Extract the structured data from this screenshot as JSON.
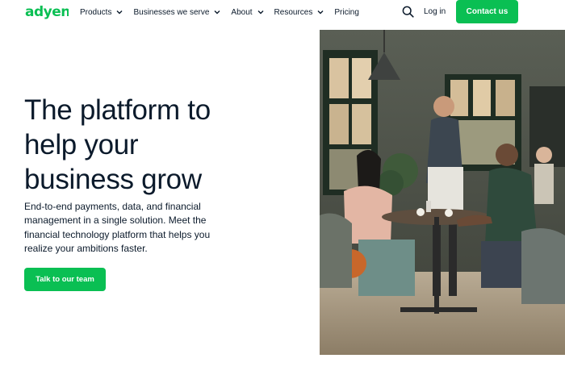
{
  "brand": {
    "logo_text": "adyen",
    "accent_color": "#0abf53",
    "text_color": "#0b1a2b"
  },
  "nav": {
    "items": [
      {
        "label": "Products",
        "has_dropdown": true
      },
      {
        "label": "Businesses we serve",
        "has_dropdown": true
      },
      {
        "label": "About",
        "has_dropdown": true
      },
      {
        "label": "Resources",
        "has_dropdown": true
      },
      {
        "label": "Pricing",
        "has_dropdown": false
      }
    ],
    "search_icon": "search-icon",
    "login_label": "Log in",
    "contact_label": "Contact us"
  },
  "hero": {
    "title_lines": [
      "The platform to",
      "help your",
      "business grow"
    ],
    "description": "End-to-end payments, data, and financial management in a single solution. Meet the financial technology platform that helps you realize your ambitions faster.",
    "cta_label": "Talk to our team",
    "image_subject": "cafe-scene-photo"
  }
}
